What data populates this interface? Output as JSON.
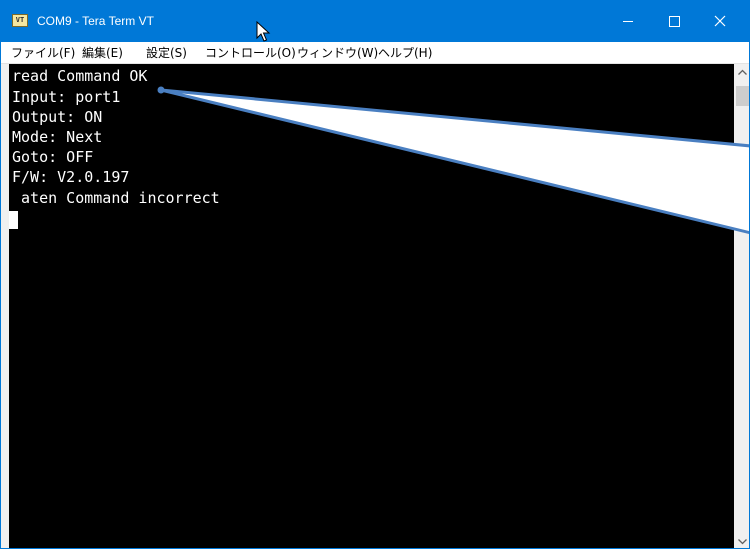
{
  "window": {
    "title": "COM9 - Tera Term VT",
    "icon_label": "VT",
    "accent_color": "#0078d7"
  },
  "menu": {
    "items": [
      {
        "label": "ファイル(F)"
      },
      {
        "label": "編集(E)"
      },
      {
        "label": "設定(S)"
      },
      {
        "label": "コントロール(O)"
      },
      {
        "label": "ウィンドウ(W)"
      },
      {
        "label": "ヘルプ(H)"
      }
    ]
  },
  "terminal": {
    "lines": [
      "read Command OK",
      "Input: port1",
      "Output: ON",
      "Mode: Next",
      "Goto: OFF",
      "F/W: V2.0.197",
      " aten Command incorrect"
    ],
    "background": "#000000",
    "foreground": "#ffffff"
  },
  "icons": {
    "minimize": "minimize-icon",
    "maximize": "maximize-icon",
    "close": "close-icon",
    "scroll_up": "chevron-up-icon",
    "scroll_down": "chevron-down-icon",
    "cursor": "mouse-pointer-icon"
  }
}
